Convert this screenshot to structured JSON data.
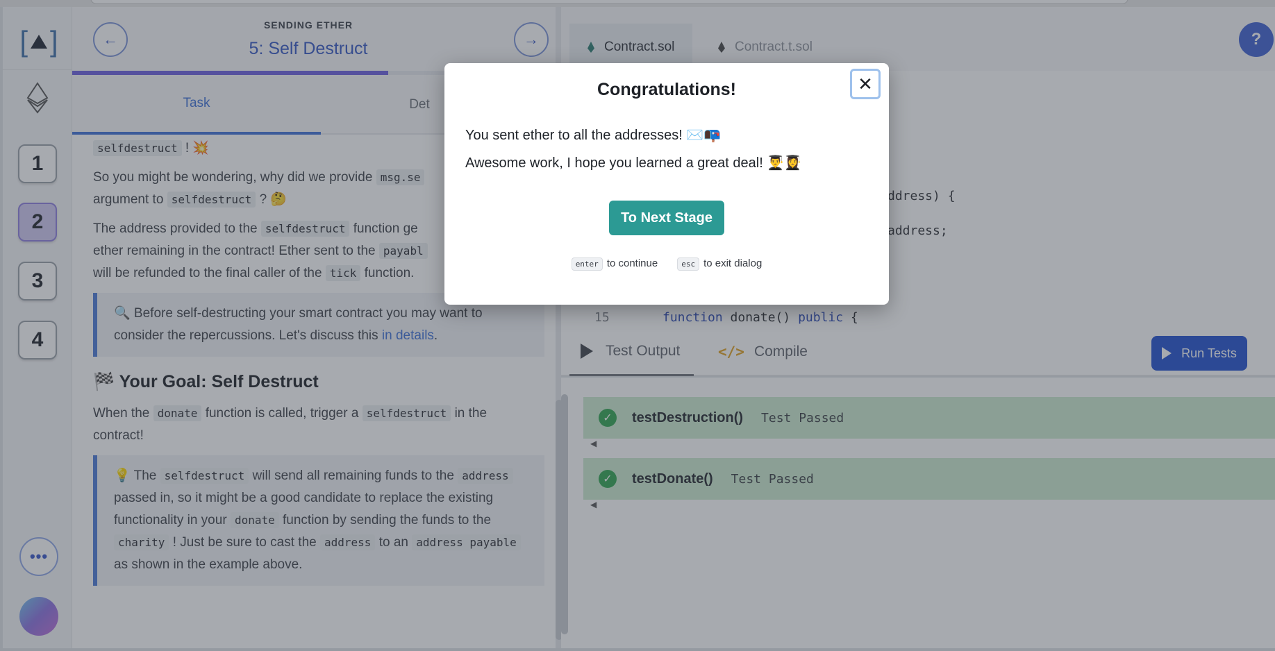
{
  "lesson": {
    "kicker": "SENDING ETHER",
    "title": "5: Self Destruct",
    "prev_icon": "arrow-left-icon",
    "next_icon": "arrow-right-icon",
    "progress": 0.65,
    "tabs": [
      {
        "label": "Task"
      },
      {
        "label": "Det"
      }
    ],
    "stages": [
      "1",
      "2",
      "3",
      "4"
    ],
    "active_stage": "2",
    "body": {
      "p0_code": "selfdestruct",
      "p0_tail": "! 💥",
      "p1_a": "So you might be wondering, why did we provide",
      "p1_code1": "msg.se",
      "p1_b": "argument to",
      "p1_code2": "selfdestruct",
      "p1_c": "? 🤔",
      "p2_a": "The address provided to the",
      "p2_code1": "selfdestruct",
      "p2_b": "function ge",
      "p2_c": "ether remaining in the contract! Ether sent to the",
      "p2_code2": "payabl",
      "p2_d": "will be refunded to the final caller of the",
      "p2_code3": "tick",
      "p2_e": "function.",
      "note1_a": "🔍 Before self-destructing your smart contract you may want to consider the repercussions. Let's discuss this",
      "note1_link": "in details",
      "note1_b": ".",
      "goal": "🏁 Your Goal: Self Destruct",
      "p3_a": "When the",
      "p3_code1": "donate",
      "p3_b": "function is called, trigger a",
      "p3_code2": "selfdestruct",
      "p3_c": "in the contract!",
      "note2_a": "💡 The",
      "note2_code1": "selfdestruct",
      "note2_b": "will send all remaining funds to the",
      "note2_code2": "address",
      "note2_c": "passed in, so it might be a good candidate to replace the existing functionality in your",
      "note2_code3": "donate",
      "note2_d": "function by sending the funds to the",
      "note2_code4": "charity",
      "note2_e": "! Just be sure to cast the",
      "note2_code5": "address",
      "note2_f": "to an",
      "note2_code6": "address payable",
      "note2_g": "as shown in the example above."
    }
  },
  "editor": {
    "files": [
      {
        "label": "Contract.sol"
      },
      {
        "label": "Contract.t.sol"
      }
    ],
    "help_label": "?",
    "code": {
      "line_a": "ddress) {",
      "line_b": "address;",
      "line_number": "15",
      "line_c_kw1": "function",
      "line_c_mid": " donate() ",
      "line_c_kw2": "public",
      "line_c_end": " {"
    },
    "test_tabs": {
      "output": "Test Output",
      "compile": "Compile"
    },
    "run_label": "Run Tests",
    "results": [
      {
        "name": "testDestruction()",
        "status": "Test Passed"
      },
      {
        "name": "testDonate()",
        "status": "Test Passed"
      }
    ],
    "pass_color": "#cdeccf"
  },
  "modal": {
    "title": "Congratulations!",
    "line1": "You sent ether to all the addresses! ✉️📭",
    "line2": "Awesome work, I hope you learned a great deal! 👨‍🎓👩‍🎓",
    "button": "To Next Stage",
    "hint_enter_key": "enter",
    "hint_enter_text": "to continue",
    "hint_esc_key": "esc",
    "hint_esc_text": "to exit dialog",
    "close_icon": "close-icon"
  },
  "colors": {
    "accent": "#3456c4",
    "teal": "#2c9a94",
    "progress": "#6a5de0"
  }
}
